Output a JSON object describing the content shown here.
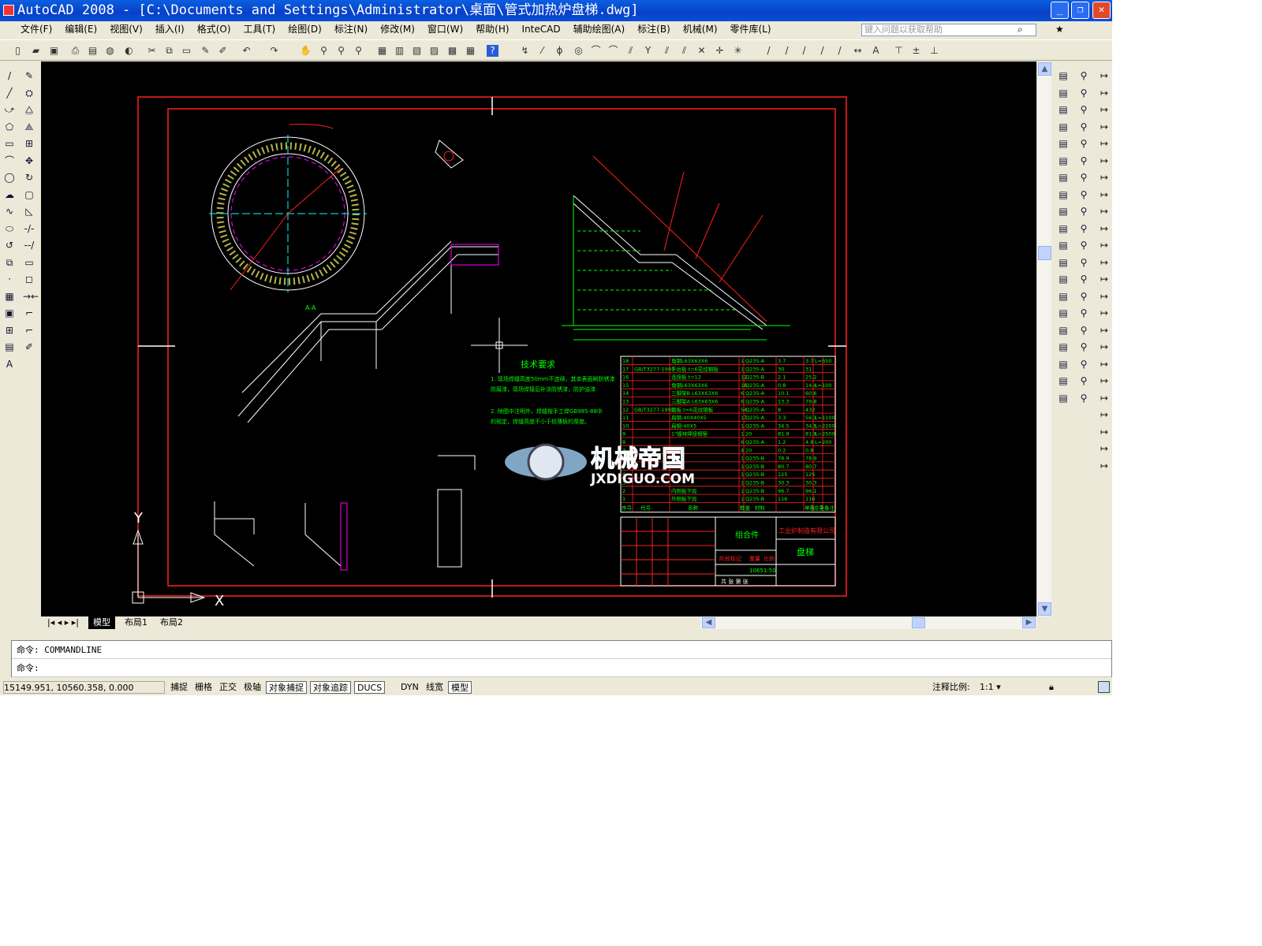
{
  "title": "AutoCAD 2008 - [C:\\Documents and Settings\\Administrator\\桌面\\管式加热炉盘梯.dwg]",
  "window_buttons": {
    "minimize": "_",
    "restore": "❐",
    "close": "✕"
  },
  "menu": [
    "文件(F)",
    "编辑(E)",
    "视图(V)",
    "插入(I)",
    "格式(O)",
    "工具(T)",
    "绘图(D)",
    "标注(N)",
    "修改(M)",
    "窗口(W)",
    "帮助(H)",
    "InteCAD",
    "辅助绘图(A)",
    "标注(B)",
    "机械(M)",
    "零件库(L)"
  ],
  "help_placeholder": "键入问题以获取帮助",
  "drawing": {
    "tech_title": "技术要求",
    "tech_notes": [
      "1. 现场焊缝高度50mm不连续，其余表面刷防锈漆",
      "   防腐漆，现场焊接后补涂防锈漆，防护油漆",
      "2. 除图中注明外，焊缝按手工焊GB985-88中",
      "   的规定，焊缝高度不小于较薄板的厚度。"
    ],
    "parts": [
      [
        "18",
        "",
        "角钢L63X63X6",
        "1",
        "Q235-A",
        "3.7",
        "3.7",
        "L=650"
      ],
      [
        "17",
        "GB/T3277-1991",
        "平台板 t=6花纹钢板",
        "1",
        "Q235-A",
        "30",
        "31",
        ""
      ],
      [
        "16",
        "",
        "连接板 t=12",
        "12",
        "Q235-B",
        "2.1",
        "25.2",
        ""
      ],
      [
        "15",
        "",
        "角钢L63X63X6",
        "18",
        "Q235-A",
        "0.8",
        "14.4",
        "L=100"
      ],
      [
        "14",
        "",
        "三脚架B L63X63X6",
        "6",
        "Q235-A",
        "10.1",
        "60.6",
        ""
      ],
      [
        "13",
        "",
        "三脚架A L63X63X6",
        "6",
        "Q235-A",
        "13.3",
        "79.8",
        ""
      ],
      [
        "12",
        "GB/T3277-1991",
        "踏板 t=6花纹钢板",
        "54",
        "Q235-A",
        "8",
        "432",
        ""
      ],
      [
        "11",
        "",
        "扁钢-40X40X5",
        "17",
        "Q235-A",
        "3.3",
        "56.1",
        "L=1100"
      ],
      [
        "10",
        "",
        "扁钢-40X5",
        "1",
        "Q235-A",
        "34.5",
        "34.5",
        "L=2200"
      ],
      [
        "9",
        "",
        "1\"镀锌焊接钢管",
        "1",
        "20",
        "81.9",
        "81.9",
        "L=2500"
      ],
      [
        "8",
        "",
        "",
        "6",
        "Q235-A",
        "1.2",
        "4.8",
        "L=200"
      ],
      [
        "7",
        "",
        "",
        "4",
        "20",
        "0.2",
        "0.8",
        ""
      ],
      [
        "6",
        "",
        "",
        "1",
        "Q235-B",
        "78.9",
        "78.9",
        ""
      ],
      [
        "5",
        "",
        "",
        "1",
        "Q235-B",
        "80.7",
        "80.7",
        ""
      ],
      [
        "4",
        "",
        "",
        "1",
        "Q235-B",
        "125",
        "125",
        ""
      ],
      [
        "3",
        "",
        "",
        "1",
        "Q235-B",
        "30.3",
        "30.3",
        ""
      ],
      [
        "2",
        "",
        "内侧板下段",
        "1",
        "Q235-B",
        "96.7",
        "96.1",
        ""
      ],
      [
        "1",
        "",
        "外侧板下段",
        "1",
        "Q235-B",
        "116",
        "116",
        ""
      ]
    ],
    "parts_header": [
      "序号",
      "代号",
      "名称",
      "数量",
      "材料",
      "单重",
      "总重",
      "备注"
    ],
    "title_block": {
      "type": "组合件",
      "company": "工业炉制造有限公司",
      "name": "盘梯",
      "stage": "阶段标记",
      "weight_label": "重量",
      "scale_label": "比例",
      "weight": "1065",
      "scale": "1:50",
      "sheet": "共 张 第 张"
    },
    "section_label": "A-A",
    "watermark": "机械帝国",
    "watermark_url": "JXDIGUO.COM",
    "ucs_y": "Y",
    "ucs_x": "X"
  },
  "tabs": [
    "模型",
    "布局1",
    "布局2"
  ],
  "command": {
    "history": "命令: COMMANDLINE",
    "prompt": "命令:"
  },
  "status": {
    "coords": "15149.951, 10560.358, 0.000",
    "buttons": [
      {
        "label": "捕捉",
        "on": false
      },
      {
        "label": "栅格",
        "on": false
      },
      {
        "label": "正交",
        "on": false
      },
      {
        "label": "极轴",
        "on": false
      },
      {
        "label": "对象捕捉",
        "on": true
      },
      {
        "label": "对象追踪",
        "on": true
      },
      {
        "label": "DUCS",
        "on": true
      },
      {
        "label": "DYN",
        "on": false
      },
      {
        "label": "线宽",
        "on": false
      },
      {
        "label": "模型",
        "on": true
      }
    ],
    "annot_label": "注释比例:",
    "annot_scale": "1:1 ▾"
  },
  "colors": {
    "canvas": "#000000",
    "frame": "#ff2020",
    "geometry": "#00ff00",
    "title_bar": "#0a4fd8"
  }
}
